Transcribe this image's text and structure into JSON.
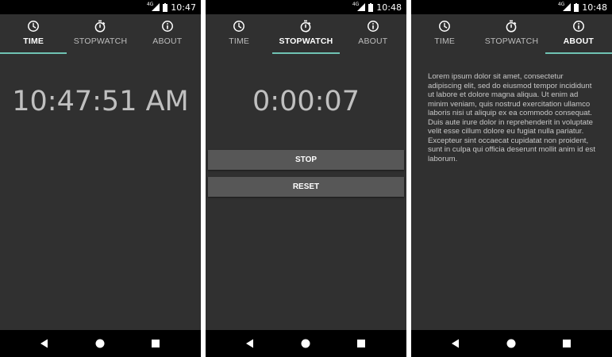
{
  "status_bar": {
    "network": "4G",
    "times": [
      "10:47",
      "10:48",
      "10:48"
    ]
  },
  "tabs": [
    {
      "id": "time",
      "label": "TIME",
      "icon": "clock-icon"
    },
    {
      "id": "stopwatch",
      "label": "STOPWATCH",
      "icon": "stopwatch-icon"
    },
    {
      "id": "about",
      "label": "ABOUT",
      "icon": "info-icon"
    }
  ],
  "screens": {
    "time": {
      "active_tab": "time",
      "clock_value": "10:47:51 AM"
    },
    "stopwatch": {
      "active_tab": "stopwatch",
      "elapsed": "0:00:07",
      "stop_label": "STOP",
      "reset_label": "RESET"
    },
    "about": {
      "active_tab": "about",
      "body": "Lorem ipsum dolor sit amet, consectetur adipiscing elit, sed do eiusmod tempor incididunt ut labore et dolore magna aliqua. Ut enim ad minim veniam, quis nostrud exercitation ullamco laboris nisi ut aliquip ex ea commodo consequat. Duis aute irure dolor in reprehenderit in voluptate velit esse cillum dolore eu fugiat nulla pariatur. Excepteur sint occaecat cupidatat non proident, sunt in culpa qui officia deserunt mollit anim id est laborum."
    }
  },
  "nav_bar": {
    "icons": [
      "back-icon",
      "home-icon",
      "recents-icon"
    ]
  },
  "colors": {
    "accent": "#6fc3b3",
    "background": "#303030",
    "button": "#575757",
    "bars": "#000000"
  }
}
